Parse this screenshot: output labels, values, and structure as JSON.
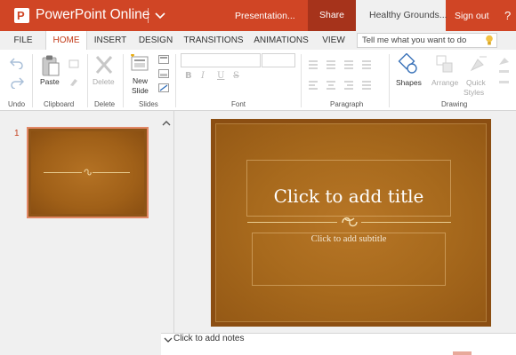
{
  "titlebar": {
    "app_name": "PowerPoint Online",
    "document_name": "Presentation...",
    "share_label": "Share",
    "user_label": "Healthy Grounds...",
    "signout_label": "Sign out",
    "help_label": "?",
    "logo_letter": "P"
  },
  "tabs": [
    {
      "label": "FILE",
      "active": false
    },
    {
      "label": "HOME",
      "active": true
    },
    {
      "label": "INSERT",
      "active": false
    },
    {
      "label": "DESIGN",
      "active": false
    },
    {
      "label": "TRANSITIONS",
      "active": false
    },
    {
      "label": "ANIMATIONS",
      "active": false
    },
    {
      "label": "VIEW",
      "active": false
    }
  ],
  "tell_me": {
    "placeholder": "Tell me what you want to do"
  },
  "ribbon": {
    "groups": {
      "undo": "Undo",
      "clipboard": "Clipboard",
      "delete": "Delete",
      "slides": "Slides",
      "font": "Font",
      "paragraph": "Paragraph",
      "drawing": "Drawing"
    },
    "buttons": {
      "paste": "Paste",
      "delete": "Delete",
      "new_slide_line1": "New",
      "new_slide_line2": "Slide",
      "shapes": "Shapes",
      "arrange": "Arrange",
      "quick_styles_line1": "Quick",
      "quick_styles_line2": "Styles",
      "bold": "B",
      "italic": "I",
      "underline": "U",
      "strike": "S"
    }
  },
  "thumbnails": [
    {
      "number": "1"
    }
  ],
  "slide": {
    "title_placeholder": "Click to add title",
    "subtitle_placeholder": "Click to add subtitle",
    "ornament": "ぷ"
  },
  "notes": {
    "placeholder": "Click to add notes"
  },
  "colors": {
    "accent": "#d04525",
    "share": "#a6331b",
    "slide_brown": "#a86a1d"
  }
}
